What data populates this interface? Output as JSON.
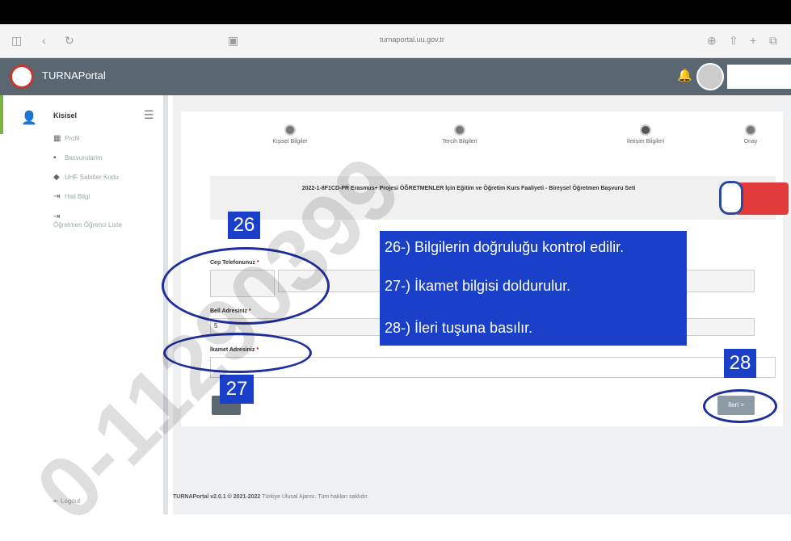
{
  "browser": {
    "url": "turnaportal.uu.gov.tr"
  },
  "app": {
    "brand": "TURNAPortal"
  },
  "sidebar": {
    "title": "Kisisel",
    "items": [
      {
        "label": "Profil",
        "icon": "table-icon"
      },
      {
        "label": "Basvurularim",
        "icon": "trash-icon"
      },
      {
        "label": "UHF Sabitler Kodu",
        "icon": "tag-icon"
      },
      {
        "label": "Hali Bilgi",
        "icon": "login-icon"
      },
      {
        "label": "Öğretmen Öğrenci Liste",
        "icon": "login-icon"
      }
    ],
    "logout": "Logout"
  },
  "steps": [
    {
      "label": "Kişisel Bilgiler"
    },
    {
      "label": "Tercih Bilgileri"
    },
    {
      "label": "İletişim Bilgileri"
    },
    {
      "label": "Onay"
    }
  ],
  "banner": {
    "text": "2022-1-8F1CD-PR Erasmus+ Projesi ÖĞRETMENLER İçin Eğitim ve Öğretim Kurs Faaliyeti - Bireysel Öğretmen Başvuru Seti"
  },
  "form": {
    "phone_label": "Cep Telefonunuz",
    "birth_label": "Bell Adresiniz",
    "birth_value": "5",
    "address_label": "İkamet Adresiniz",
    "required_mark": "*",
    "next_label": "İleri >"
  },
  "annotations": {
    "badge_26": "26",
    "badge_27": "27",
    "badge_28": "28",
    "line_26": "26-) Bilgilerin doğruluğu kontrol edilir.",
    "line_27": "27-) İkamet bilgisi doldurulur.",
    "line_28": "28-) İleri tuşuna basılır."
  },
  "footer": {
    "version": "TURNAPortal v2.0.1 © 2021-2022",
    "text": "Türkiye Ulusal Ajansı. Tüm hakları saklıdır."
  },
  "watermark": "0-11290399"
}
